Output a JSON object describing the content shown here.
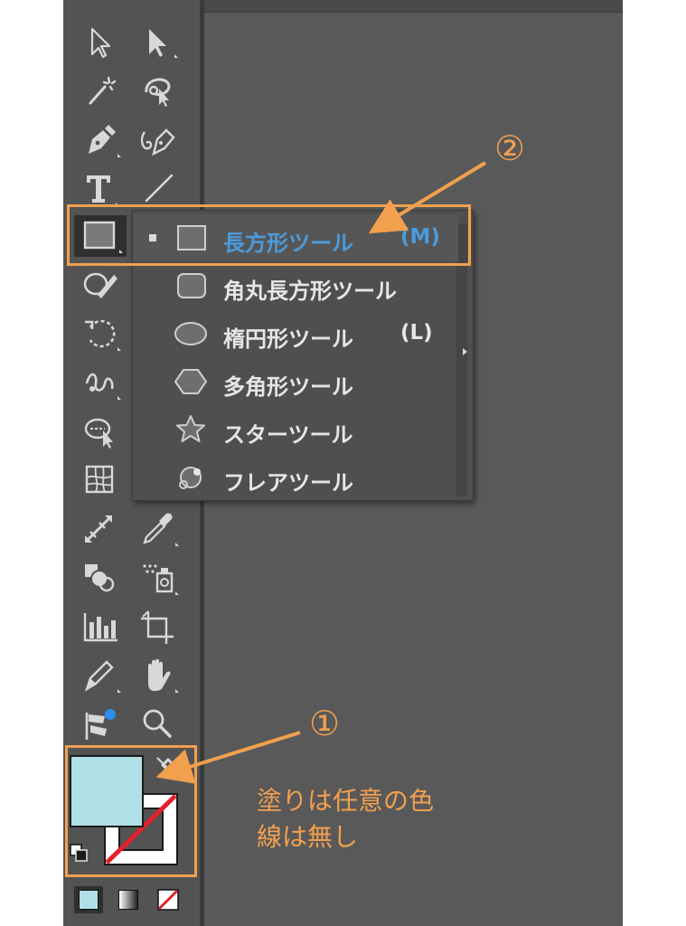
{
  "flyout": {
    "items": [
      {
        "label": "長方形ツール",
        "shortcut": "(M)",
        "icon": "rectangle-icon",
        "selected": true
      },
      {
        "label": "角丸長方形ツール",
        "shortcut": "",
        "icon": "rounded-rectangle-icon",
        "selected": false
      },
      {
        "label": "楕円形ツール",
        "shortcut": "(L)",
        "icon": "ellipse-icon",
        "selected": false
      },
      {
        "label": "多角形ツール",
        "shortcut": "",
        "icon": "polygon-icon",
        "selected": false
      },
      {
        "label": "スターツール",
        "shortcut": "",
        "icon": "star-icon",
        "selected": false
      },
      {
        "label": "フレアツール",
        "shortcut": "",
        "icon": "flare-icon",
        "selected": false
      }
    ]
  },
  "toolbar": {
    "tools": [
      "selection-icon",
      "direct-selection-icon",
      "magic-wand-icon",
      "lasso-icon",
      "pen-icon",
      "curvature-icon",
      "type-icon",
      "line-segment-icon",
      "rectangle-icon",
      "shaper-icon",
      "rotate-icon",
      "warp-icon",
      "shape-builder-icon",
      "mesh-icon",
      "blend-icon",
      "eyedropper-icon",
      "live-paint-icon",
      "symbol-sprayer-icon",
      "column-graph-icon",
      "artboard-icon",
      "slice-icon",
      "hand-icon",
      "puppet-warp-icon",
      "zoom-icon"
    ],
    "fill_color": "#b0e0e6",
    "stroke": "none"
  },
  "annotations": {
    "marker1": "①",
    "marker2": "②",
    "note_line1": "塗りは任意の色",
    "note_line2": "線は無し",
    "accent_color": "#f2a04e"
  },
  "colors": {
    "selected_text": "#4b9bdc",
    "menu_text": "#e6e6e6"
  }
}
